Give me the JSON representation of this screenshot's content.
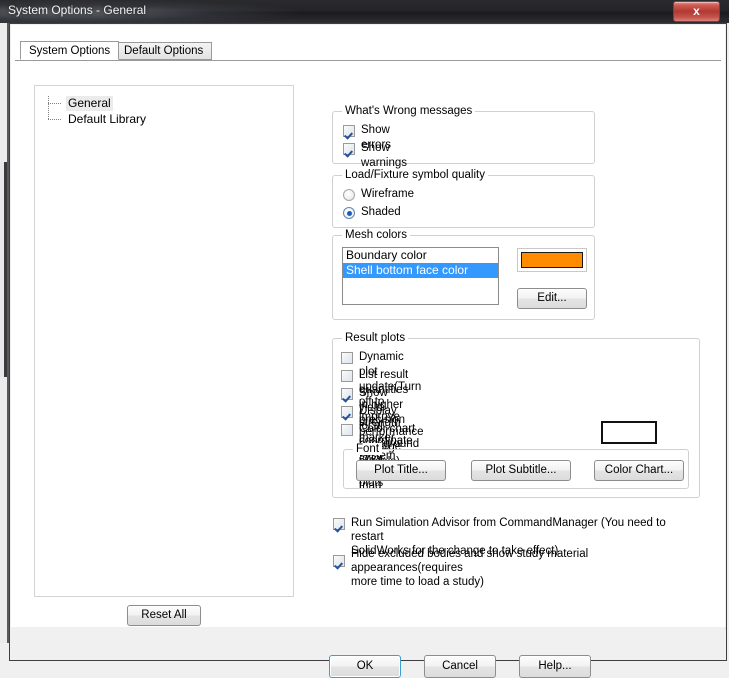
{
  "window": {
    "title": "System Options - General",
    "close_label": "x"
  },
  "tabs": [
    {
      "label": "System Options",
      "active": true
    },
    {
      "label": "Default Options",
      "active": false
    }
  ],
  "tree": {
    "items": [
      {
        "label": "General",
        "selected": true
      },
      {
        "label": "Default Library",
        "selected": false
      }
    ]
  },
  "reset": {
    "label": "Reset All"
  },
  "groups": {
    "whats_wrong": {
      "title": "What's Wrong messages",
      "checkboxes": [
        {
          "label": "Show errors",
          "checked": true
        },
        {
          "label": "Show warnings",
          "checked": true
        }
      ]
    },
    "symbol_quality": {
      "title": "Load/Fixture symbol quality",
      "radios": [
        {
          "label": "Wireframe",
          "selected": false
        },
        {
          "label": "Shaded",
          "selected": true
        }
      ]
    },
    "mesh_colors": {
      "title": "Mesh colors",
      "list": [
        {
          "label": "Boundary color",
          "selected": false
        },
        {
          "label": "Shell bottom face color",
          "selected": true
        }
      ],
      "swatch_color": "#FF8C00",
      "edit_label": "Edit..."
    },
    "result_plots": {
      "title": "Result plots",
      "checkboxes": [
        {
          "label": "Dynamic plot update(Turn off to improve performance for large models)",
          "checked": false
        },
        {
          "label": "List result quantities in higher precision",
          "checked": false
        },
        {
          "label": "Show yield strength marker for vonMises plots",
          "checked": true
        },
        {
          "label": "Display local coordinate system reference triad",
          "checked": true
        },
        {
          "label": "Color chart background color",
          "checked": false
        }
      ],
      "background_swatch_color": "#FFFFFF",
      "font": {
        "title": "Font",
        "buttons": [
          {
            "label": "Plot Title..."
          },
          {
            "label": "Plot Subtitle..."
          },
          {
            "label": "Color Chart..."
          }
        ]
      }
    }
  },
  "bottom_checkboxes": [
    {
      "line1": "Run Simulation Advisor from CommandManager (You need to restart",
      "line2": "SolidWorks for the change to take effect)",
      "checked": true
    },
    {
      "line1": "Hide excluded bodies and show study material appearances(requires",
      "line2": "more time to load a study)",
      "checked": true
    }
  ],
  "footer": {
    "ok_label": "OK",
    "cancel_label": "Cancel",
    "help_label": "Help..."
  }
}
